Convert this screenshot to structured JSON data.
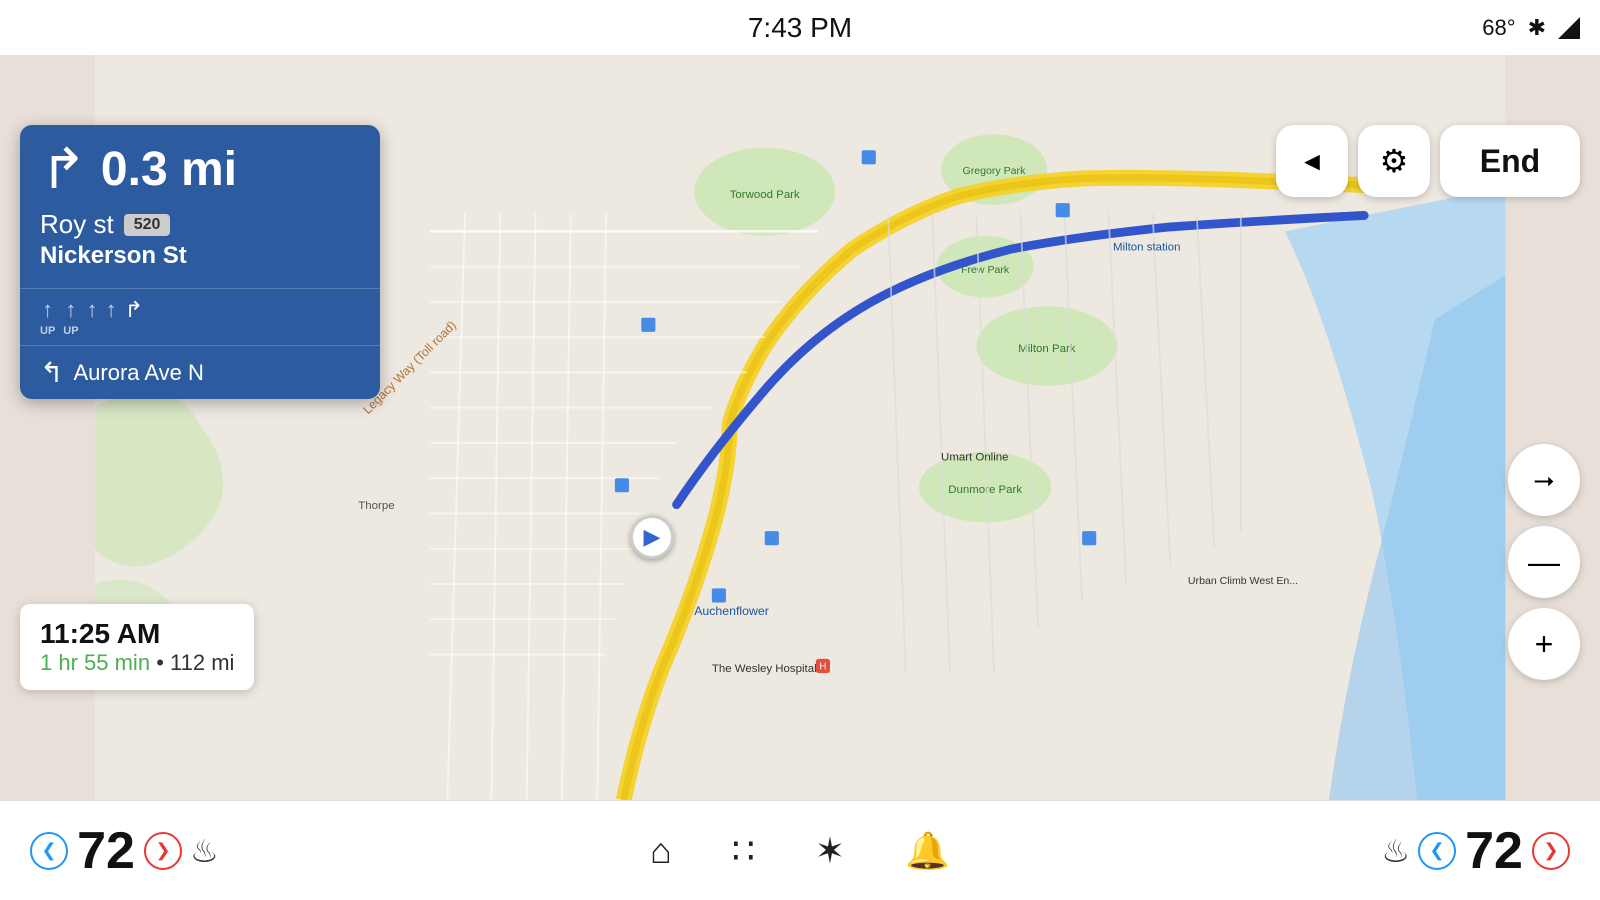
{
  "status": {
    "time": "7:43 PM",
    "temperature": "68°",
    "bluetooth": "⌁",
    "signal": "▮"
  },
  "navigation": {
    "distance": "0.3 mi",
    "turn_arrow": "↱",
    "street_name": "Roy st",
    "route_badge": "520",
    "cross_street": "Nickerson St",
    "next_turn_label": "Aurora Ave N",
    "lanes": [
      {
        "label": "UP",
        "active": false
      },
      {
        "label": "UP",
        "active": false
      },
      {
        "label": "",
        "active": false
      },
      {
        "label": "",
        "active": false
      },
      {
        "label": "",
        "active": true
      }
    ]
  },
  "eta": {
    "arrival_time": "11:25 AM",
    "duration": "1 hr 55 min",
    "distance": "112 mi"
  },
  "controls": {
    "mute_label": "🔇",
    "settings_label": "⚙",
    "end_label": "End"
  },
  "bottom_bar": {
    "left_temp": "72",
    "right_temp": "72",
    "left_heat_icon": "🌡",
    "right_heat_icon": "🌡",
    "home_icon": "⌂",
    "grid_icon": "⊞",
    "fan_icon": "✾",
    "bell_icon": "🔔"
  },
  "map": {
    "location_name": "Auchenflower",
    "parks": [
      "Torwood Park",
      "Gregory Park",
      "Frew Park",
      "Milton Park",
      "Dunmore Park"
    ],
    "roads": [
      "Legacy Way (Toll road)",
      "Milton station"
    ]
  }
}
